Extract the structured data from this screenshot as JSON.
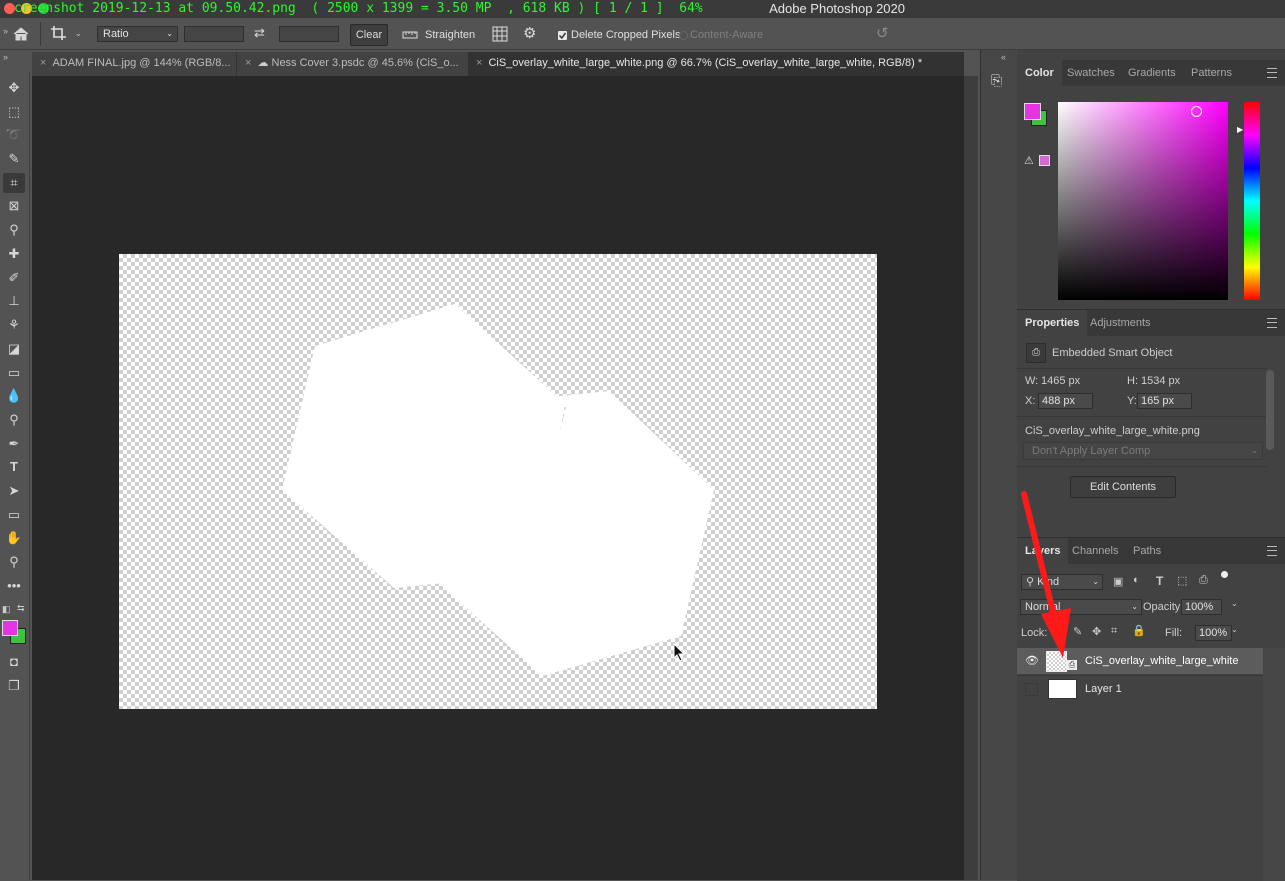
{
  "titlebar": {
    "overlay_text": "creenshot 2019-12-13 at 09.50.42.png  ( 2500 x 1399 = 3.50 MP  , 618 KB ) [ 1 / 1 ]  64%",
    "app_title": "Adobe Photoshop 2020"
  },
  "options": {
    "ratio_label": "Ratio",
    "clear_label": "Clear",
    "straighten_label": "Straighten",
    "delete_cropped_label": "Delete Cropped Pixels",
    "content_aware_label": "Content-Aware"
  },
  "tabs": [
    {
      "label": "ADAM FINAL.jpg @ 144% (RGB/8..."
    },
    {
      "label": "Ness Cover 3.psdc @ 45.6% (CiS_o..."
    },
    {
      "label": "CiS_overlay_white_large_white.png @ 66.7% (CiS_overlay_white_large_white, RGB/8) *"
    }
  ],
  "colors": {
    "foreground": "#e633e6",
    "background": "#3fc23f",
    "alert_swatch": "#d46bd4"
  },
  "color_panel": {
    "tabs": [
      "Color",
      "Swatches",
      "Gradients",
      "Patterns"
    ]
  },
  "properties": {
    "tabs": [
      "Properties",
      "Adjustments"
    ],
    "object_type": "Embedded Smart Object",
    "w_label": "W:",
    "w_value": "1465 px",
    "h_label": "H:",
    "h_value": "1534 px",
    "x_label": "X:",
    "x_value": "488 px",
    "y_label": "Y:",
    "y_value": "165 px",
    "filename": "CiS_overlay_white_large_white.png",
    "layer_comp": "Don't Apply Layer Comp",
    "edit_contents": "Edit Contents"
  },
  "layers": {
    "tabs": [
      "Layers",
      "Channels",
      "Paths"
    ],
    "filter_kind": "Kind",
    "blend_mode": "Normal",
    "opacity_label": "Opacity:",
    "opacity_value": "100%",
    "lock_label": "Lock:",
    "fill_label": "Fill:",
    "fill_value": "100%",
    "items": [
      {
        "name": "CiS_overlay_white_large_white",
        "visible": true
      },
      {
        "name": "Layer 1",
        "visible": false
      }
    ]
  }
}
